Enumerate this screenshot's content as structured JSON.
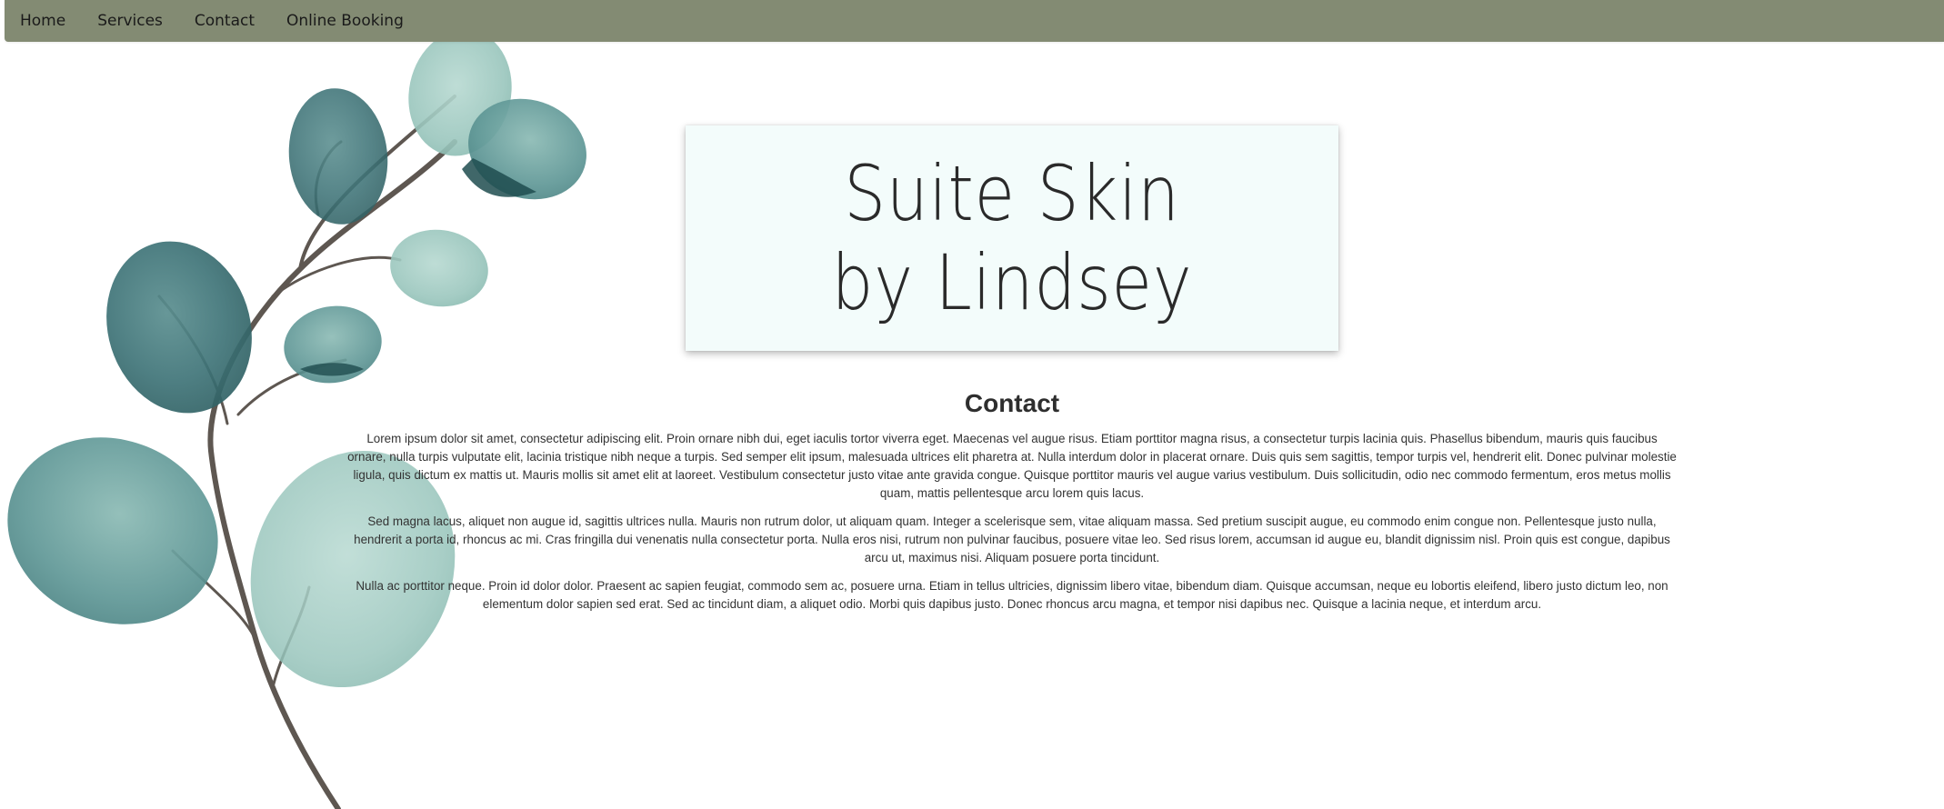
{
  "nav": {
    "items": [
      {
        "label": "Home"
      },
      {
        "label": "Services"
      },
      {
        "label": "Contact"
      },
      {
        "label": "Online Booking"
      }
    ]
  },
  "header": {
    "title": "Suite Skin by Lindsey"
  },
  "main": {
    "heading": "Contact",
    "paragraphs": [
      "Lorem ipsum dolor sit amet, consectetur adipiscing elit. Proin ornare nibh dui, eget iaculis tortor viverra eget. Maecenas vel augue risus. Etiam porttitor magna risus, a consectetur turpis lacinia quis. Phasellus bibendum, mauris quis faucibus ornare, nulla turpis vulputate elit, lacinia tristique nibh neque a turpis. Sed semper elit ipsum, malesuada ultrices elit pharetra at. Nulla interdum dolor in placerat ornare. Duis quis sem sagittis, tempor turpis vel, hendrerit elit. Donec pulvinar molestie ligula, quis dictum ex mattis ut. Mauris mollis sit amet elit at laoreet. Vestibulum consectetur justo vitae ante gravida congue. Quisque porttitor mauris vel augue varius vestibulum. Duis sollicitudin, odio nec commodo fermentum, eros metus mollis quam, mattis pellentesque arcu lorem quis lacus.",
      "Sed magna lacus, aliquet non augue id, sagittis ultrices nulla. Mauris non rutrum dolor, ut aliquam quam. Integer a scelerisque sem, vitae aliquam massa. Sed pretium suscipit augue, eu commodo enim congue non. Pellentesque justo nulla, hendrerit a porta id, rhoncus ac mi. Cras fringilla dui venenatis nulla consectetur porta. Nulla eros nisi, rutrum non pulvinar faucibus, posuere vitae leo. Sed risus lorem, accumsan id augue eu, blandit dignissim nisl. Proin quis est congue, dapibus arcu ut, maximus nisi. Aliquam posuere porta tincidunt.",
      "Nulla ac porttitor neque. Proin id dolor dolor. Praesent ac sapien feugiat, commodo sem ac, posuere urna. Etiam in tellus ultricies, dignissim libero vitae, bibendum diam. Quisque accumsan, neque eu lobortis eleifend, libero justo dictum leo, non elementum dolor sapien sed erat. Sed ac tincidunt diam, a aliquet odio. Morbi quis dapibus justo. Donec rhoncus arcu magna, et tempor nisi dapibus nec. Quisque a lacinia neque, et interdum arcu."
    ]
  },
  "colors": {
    "nav_bg": "#838b73",
    "card_bg": "#f3fcfb",
    "leaf_dark": "#3e7377",
    "leaf_light": "#9cc7bf",
    "stem": "#5e5751"
  },
  "icons": {
    "decoration": "eucalyptus-branch-illustration"
  }
}
